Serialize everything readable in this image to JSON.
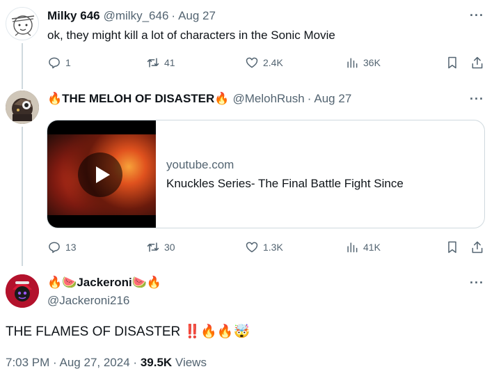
{
  "tweets": [
    {
      "name": "Milky 646",
      "handle": "@milky_646",
      "sep": "·",
      "date": "Aug 27",
      "text": "ok, they might kill a lot of characters in the Sonic Movie",
      "replies": "1",
      "reposts": "41",
      "likes": "2.4K",
      "views": "36K"
    },
    {
      "name_prefix": "🔥",
      "name": "THE MELOH OF DISASTER",
      "name_suffix": "🔥",
      "handle": "@MelohRush",
      "sep": "·",
      "date": "Aug 27",
      "card": {
        "domain": "youtube.com",
        "title": "Knuckles Series- The Final Battle Fight Since"
      },
      "replies": "13",
      "reposts": "30",
      "likes": "1.3K",
      "views": "41K"
    }
  ],
  "main": {
    "name_prefix": "🔥🍉",
    "name": "Jackeroni",
    "name_suffix": "🍉🔥",
    "handle": "@Jackeroni216",
    "text": "THE FLAMES OF DISASTER",
    "text_emoji": "‼️🔥🔥🤯",
    "time": "7:03 PM",
    "sep": "·",
    "date": "Aug 27, 2024",
    "views_count": "39.5K",
    "views_label": "Views"
  },
  "more_glyph": "···",
  "colors": {
    "secondary": "#536471",
    "primary": "#0f1419",
    "border": "#cfd9de"
  }
}
